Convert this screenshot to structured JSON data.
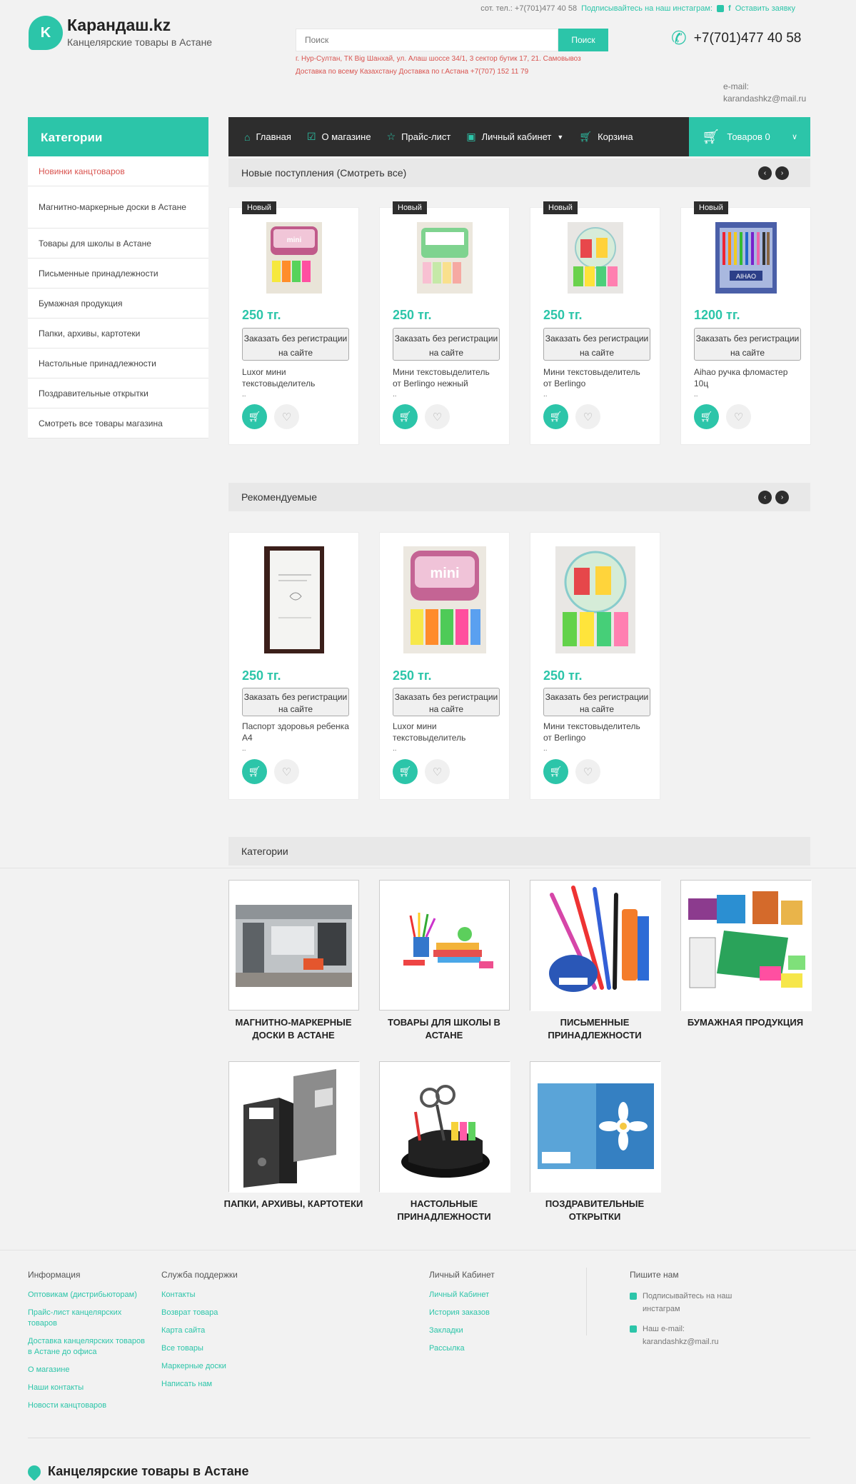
{
  "header": {
    "top_phone": "сот. тел.: +7(701)477 40 58",
    "top_instagram": "Подписывайтесь на наш инстаграм:",
    "top_request": "Оставить заявку",
    "logo_letter": "K",
    "logo_title": "Карандаш.kz",
    "logo_subtitle": "Канцелярские товары в Астане",
    "search_placeholder": "Поиск",
    "search_button": "Поиск",
    "address_line1": "г. Нур-Султан, ТК Big Шанхай, ул. Алаш шоссе 34/1, 3 сектор бутик 17, 21. Самовывоз",
    "address_line2": "Доставка по всему Казахстану Доставка по г.Астана +7(707) 152 11 79",
    "phone": "+7(701)477 40 58",
    "email_label": "e-mail:",
    "email": "karandashkz@mail.ru"
  },
  "sidebar": {
    "title": "Категории",
    "items": [
      "Новинки канцтоваров",
      "Магнитно-маркерные доски в Астане",
      "Товары для школы в Астане",
      "Письменные принадлежности",
      "Бумажная продукция",
      "Папки, архивы, картотеки",
      "Настольные принадлежности",
      "Поздравительные открытки",
      "Смотреть все товары магазина"
    ]
  },
  "nav": {
    "home": "Главная",
    "about": "О магазине",
    "pricelist": "Прайс-лист",
    "account": "Личный кабинет",
    "cart": "Корзина",
    "cart_summary": "Товаров 0"
  },
  "new_arrivals": {
    "title": "Новые поступления (Смотреть все)",
    "badge": "Новый",
    "order_label": "Заказать без регистрации на сайте",
    "products": [
      {
        "price": "250 тг.",
        "name": "Luxor мини текстовыделитель"
      },
      {
        "price": "250 тг.",
        "name": "Мини текстовыделитель от Berlingo нежный"
      },
      {
        "price": "250 тг.",
        "name": "Мини текстовыделитель от Berlingo"
      },
      {
        "price": "1200 тг.",
        "name": "Aihao ручка фломастер 10ц"
      }
    ]
  },
  "recommended": {
    "title": "Рекомендуемые",
    "order_label": "Заказать без регистрации на сайте",
    "products": [
      {
        "price": "250 тг.",
        "name": "Паспорт здоровья ребенка А4"
      },
      {
        "price": "250 тг.",
        "name": "Luxor мини текстовыделитель"
      },
      {
        "price": "250 тг.",
        "name": "Мини текстовыделитель от Berlingo"
      }
    ]
  },
  "categories": {
    "title": "Категории",
    "tiles": [
      "МАГНИТНО-МАРКЕРНЫЕ ДОСКИ В АСТАНЕ",
      "ТОВАРЫ ДЛЯ ШКОЛЫ В АСТАНЕ",
      "ПИСЬМЕННЫЕ ПРИНАДЛЕЖНОСТИ",
      "БУМАЖНАЯ ПРОДУКЦИЯ",
      "ПАПКИ, АРХИВЫ, КАРТОТЕКИ",
      "НАСТОЛЬНЫЕ ПРИНАДЛЕЖНОСТИ",
      "ПОЗДРАВИТЕЛЬНЫЕ ОТКРЫТКИ"
    ]
  },
  "footer": {
    "info_title": "Информация",
    "info_links": [
      "Оптовикам (дистрибьюторам)",
      "Прайс-лист канцелярских товаров",
      "Доставка канцелярских товаров в Астане до офиса",
      "О магазине",
      "Наши контакты",
      "Новости канцтоваров"
    ],
    "support_title": "Служба поддержки",
    "support_links": [
      "Контакты",
      "Возврат товара",
      "Карта сайта",
      "Все товары",
      "Маркерные доски",
      "Написать нам"
    ],
    "account_title": "Личный Кабинет",
    "account_links": [
      "Личный Кабинет",
      "История заказов",
      "Закладки",
      "Рассылка"
    ],
    "write_title": "Пишите нам",
    "write_instagram": "Подписывайтесь на наш инстаграм",
    "write_email_label": "Наш e-mail:",
    "write_email": "karandashkz@mail.ru",
    "brand": "Канцелярские товары в Астане"
  },
  "colors": {
    "accent": "#2cc5a9",
    "dark": "#2d2d2d",
    "alert": "#d9534f"
  }
}
